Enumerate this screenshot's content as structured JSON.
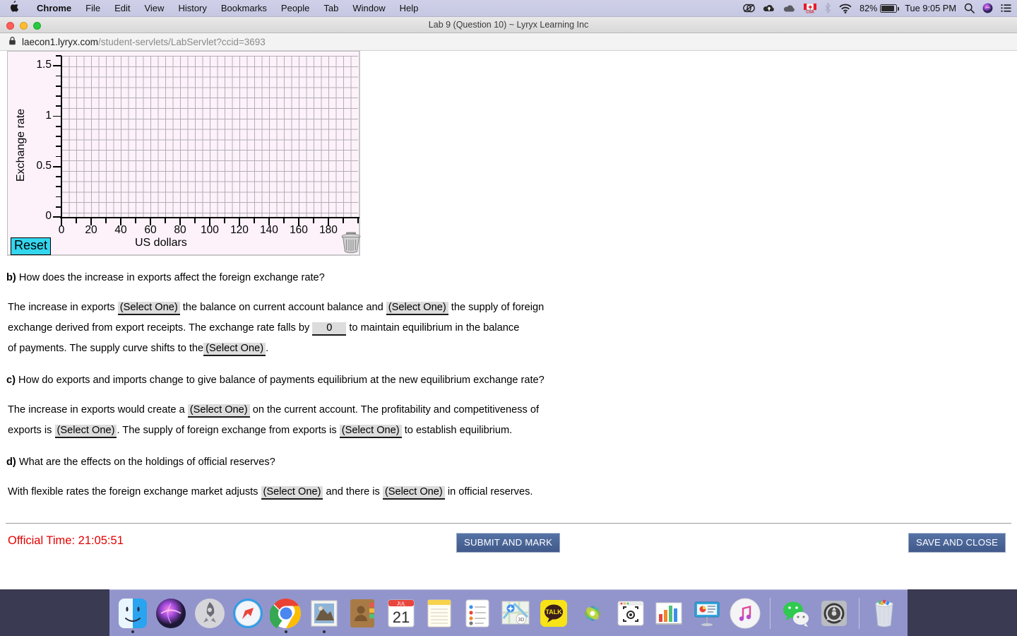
{
  "menubar": {
    "apple_icon": "apple-logo",
    "items": [
      {
        "label": "Chrome",
        "bold": true
      },
      {
        "label": "File",
        "bold": false
      },
      {
        "label": "Edit",
        "bold": false
      },
      {
        "label": "View",
        "bold": false
      },
      {
        "label": "History",
        "bold": false
      },
      {
        "label": "Bookmarks",
        "bold": false
      },
      {
        "label": "People",
        "bold": false
      },
      {
        "label": "Tab",
        "bold": false
      },
      {
        "label": "Window",
        "bold": false
      },
      {
        "label": "Help",
        "bold": false
      }
    ],
    "status": {
      "creative_cloud_icon": "creative-cloud-icon",
      "upload_cloud_icon": "cloud-upload-icon",
      "cloud_icon": "cloud-icon",
      "csa_label": "CSA",
      "bluetooth_icon": "bluetooth-icon",
      "wifi_icon": "wifi-icon",
      "battery_percent": "82%",
      "battery_icon": "battery-icon",
      "clock": "Tue 9:05 PM",
      "search_icon": "spotlight-search-icon",
      "siri_icon": "siri-icon",
      "control_center_icon": "notification-center-icon"
    }
  },
  "window": {
    "title": "Lab 9 (Question 10) ~ Lyryx Learning Inc",
    "traffic_lights": [
      "close",
      "minimize",
      "zoom"
    ]
  },
  "urlbar": {
    "lock_icon": "padlock-icon",
    "host": "laecon1.lyryx.com",
    "path": "/student-servlets/LabServlet?ccid=3693"
  },
  "chart_data": {
    "type": "scatter",
    "title": "",
    "xlabel": "US dollars",
    "ylabel": "Exchange rate",
    "xlim": [
      0,
      200
    ],
    "ylim": [
      0,
      1.6
    ],
    "xticks": [
      0,
      20,
      40,
      60,
      80,
      100,
      120,
      140,
      160,
      180
    ],
    "xtick_labels": [
      "0",
      "20",
      "40",
      "60",
      "80",
      "100",
      "120",
      "140",
      "160",
      "180"
    ],
    "yticks": [
      0,
      0.5,
      1,
      1.5
    ],
    "ytick_labels": [
      "0",
      "0.5",
      "1",
      "1.5"
    ],
    "x_minor_step": 10,
    "y_minor_step": 0.1,
    "grid": true,
    "series": [],
    "plot_background": "#fdf2fa",
    "grid_color": "#b3aeb6",
    "note": "Empty interactive plotting canvas - no data drawn"
  },
  "applet": {
    "reset_label": "Reset",
    "reset_color": "#34d6ee",
    "trash_icon": "trash-can-icon"
  },
  "questions": [
    {
      "id": "b",
      "marker": "b)",
      "prompt": "How does the increase in exports affect the foreign exchange rate?",
      "body": [
        {
          "type": "text",
          "value": "The increase in exports"
        },
        {
          "type": "select",
          "value": "(Select One)"
        },
        {
          "type": "text",
          "value": "the balance on current account balance and"
        },
        {
          "type": "select",
          "value": "(Select One)"
        },
        {
          "type": "text",
          "value": "the supply of foreign"
        }
      ],
      "body2": [
        {
          "type": "text",
          "value": "exchange derived from export receipts. The exchange rate falls by"
        },
        {
          "type": "input",
          "value": "0"
        },
        {
          "type": "text",
          "value": "to maintain equilibrium in the balance"
        }
      ],
      "body3": [
        {
          "type": "text",
          "value": "of payments. The supply curve shifts to the"
        },
        {
          "type": "select",
          "value": "(Select One)"
        },
        {
          "type": "text",
          "value": "."
        }
      ]
    },
    {
      "id": "c",
      "marker": "c)",
      "prompt": "How do exports and imports change to give balance of payments equilibrium at the new equilibrium exchange rate?",
      "body": [
        {
          "type": "text",
          "value": "The increase in exports would create a"
        },
        {
          "type": "select",
          "value": "(Select One)"
        },
        {
          "type": "text",
          "value": "on the current account. The profitability and competitiveness of"
        }
      ],
      "body2": [
        {
          "type": "text",
          "value": "exports is"
        },
        {
          "type": "select",
          "value": "(Select One)"
        },
        {
          "type": "text",
          "value": ". The supply of foreign exchange from exports is"
        },
        {
          "type": "select",
          "value": "(Select One)"
        },
        {
          "type": "text",
          "value": "to establish equilibrium."
        }
      ]
    },
    {
      "id": "d",
      "marker": "d)",
      "prompt": "What are the effects on the holdings of official reserves?",
      "body": [
        {
          "type": "text",
          "value": "With flexible rates the foreign exchange market adjusts"
        },
        {
          "type": "select",
          "value": "(Select One)"
        },
        {
          "type": "text",
          "value": "and there is"
        },
        {
          "type": "select",
          "value": "(Select One)"
        },
        {
          "type": "text",
          "value": "in official reserves."
        }
      ]
    }
  ],
  "footer": {
    "official_time_label": "Official Time: 21:05:51",
    "official_time_color": "#e40000",
    "submit_label": "SUBMIT AND MARK",
    "save_label": "SAVE AND CLOSE"
  },
  "dock": {
    "items": [
      {
        "name": "finder",
        "running": true
      },
      {
        "name": "siri",
        "running": false
      },
      {
        "name": "launchpad",
        "running": false
      },
      {
        "name": "safari",
        "running": false
      },
      {
        "name": "google-chrome",
        "running": true
      },
      {
        "name": "mail",
        "running": true
      },
      {
        "name": "contacts",
        "running": false
      },
      {
        "name": "calendar",
        "running": false,
        "badge_month": "JUL",
        "badge_day": "21"
      },
      {
        "name": "notes",
        "running": false
      },
      {
        "name": "reminders",
        "running": false
      },
      {
        "name": "maps",
        "running": false
      },
      {
        "name": "kakaotalk",
        "running": false,
        "label": "TALK"
      },
      {
        "name": "photos",
        "running": false
      },
      {
        "name": "screenshot",
        "running": false
      },
      {
        "name": "numbers",
        "running": false
      },
      {
        "name": "keynote",
        "running": false
      },
      {
        "name": "itunes",
        "running": false
      },
      {
        "name": "wechat",
        "running": false
      },
      {
        "name": "system-preferences",
        "running": false
      },
      {
        "name": "trash",
        "running": false
      }
    ]
  }
}
